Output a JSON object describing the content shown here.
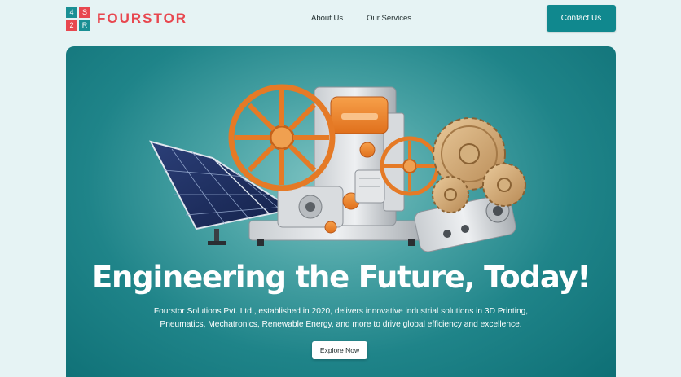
{
  "brand": {
    "logo_cells": [
      "4",
      "S",
      "2",
      "R"
    ],
    "name": "FOURSTOR",
    "primary_color": "#10888e",
    "accent_color": "#e8474f"
  },
  "nav": {
    "items": [
      {
        "label": "About Us"
      },
      {
        "label": "Our Services"
      }
    ],
    "contact_label": "Contact Us"
  },
  "hero": {
    "title": "Engineering the Future, Today!",
    "description_line1": "Fourstor Solutions Pvt. Ltd., established in 2020, delivers innovative industrial solutions in 3D Printing,",
    "description_line2": "Pneumatics, Mechatronics, Renewable Energy, and more to drive global efficiency and excellence.",
    "cta_label": "Explore Now",
    "illustration_items": [
      "solar-panel-icon",
      "film-reel-machine-icon",
      "gear-assembly-icon"
    ]
  }
}
